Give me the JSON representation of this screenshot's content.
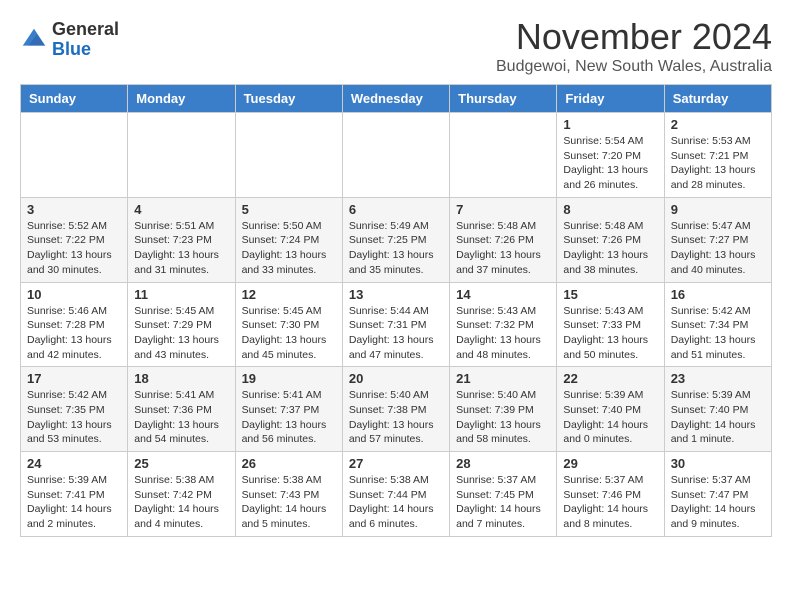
{
  "header": {
    "logo_general": "General",
    "logo_blue": "Blue",
    "month_title": "November 2024",
    "subtitle": "Budgewoi, New South Wales, Australia"
  },
  "days_of_week": [
    "Sunday",
    "Monday",
    "Tuesday",
    "Wednesday",
    "Thursday",
    "Friday",
    "Saturday"
  ],
  "weeks": [
    [
      {
        "day": "",
        "info": ""
      },
      {
        "day": "",
        "info": ""
      },
      {
        "day": "",
        "info": ""
      },
      {
        "day": "",
        "info": ""
      },
      {
        "day": "",
        "info": ""
      },
      {
        "day": "1",
        "info": "Sunrise: 5:54 AM\nSunset: 7:20 PM\nDaylight: 13 hours and 26 minutes."
      },
      {
        "day": "2",
        "info": "Sunrise: 5:53 AM\nSunset: 7:21 PM\nDaylight: 13 hours and 28 minutes."
      }
    ],
    [
      {
        "day": "3",
        "info": "Sunrise: 5:52 AM\nSunset: 7:22 PM\nDaylight: 13 hours and 30 minutes."
      },
      {
        "day": "4",
        "info": "Sunrise: 5:51 AM\nSunset: 7:23 PM\nDaylight: 13 hours and 31 minutes."
      },
      {
        "day": "5",
        "info": "Sunrise: 5:50 AM\nSunset: 7:24 PM\nDaylight: 13 hours and 33 minutes."
      },
      {
        "day": "6",
        "info": "Sunrise: 5:49 AM\nSunset: 7:25 PM\nDaylight: 13 hours and 35 minutes."
      },
      {
        "day": "7",
        "info": "Sunrise: 5:48 AM\nSunset: 7:26 PM\nDaylight: 13 hours and 37 minutes."
      },
      {
        "day": "8",
        "info": "Sunrise: 5:48 AM\nSunset: 7:26 PM\nDaylight: 13 hours and 38 minutes."
      },
      {
        "day": "9",
        "info": "Sunrise: 5:47 AM\nSunset: 7:27 PM\nDaylight: 13 hours and 40 minutes."
      }
    ],
    [
      {
        "day": "10",
        "info": "Sunrise: 5:46 AM\nSunset: 7:28 PM\nDaylight: 13 hours and 42 minutes."
      },
      {
        "day": "11",
        "info": "Sunrise: 5:45 AM\nSunset: 7:29 PM\nDaylight: 13 hours and 43 minutes."
      },
      {
        "day": "12",
        "info": "Sunrise: 5:45 AM\nSunset: 7:30 PM\nDaylight: 13 hours and 45 minutes."
      },
      {
        "day": "13",
        "info": "Sunrise: 5:44 AM\nSunset: 7:31 PM\nDaylight: 13 hours and 47 minutes."
      },
      {
        "day": "14",
        "info": "Sunrise: 5:43 AM\nSunset: 7:32 PM\nDaylight: 13 hours and 48 minutes."
      },
      {
        "day": "15",
        "info": "Sunrise: 5:43 AM\nSunset: 7:33 PM\nDaylight: 13 hours and 50 minutes."
      },
      {
        "day": "16",
        "info": "Sunrise: 5:42 AM\nSunset: 7:34 PM\nDaylight: 13 hours and 51 minutes."
      }
    ],
    [
      {
        "day": "17",
        "info": "Sunrise: 5:42 AM\nSunset: 7:35 PM\nDaylight: 13 hours and 53 minutes."
      },
      {
        "day": "18",
        "info": "Sunrise: 5:41 AM\nSunset: 7:36 PM\nDaylight: 13 hours and 54 minutes."
      },
      {
        "day": "19",
        "info": "Sunrise: 5:41 AM\nSunset: 7:37 PM\nDaylight: 13 hours and 56 minutes."
      },
      {
        "day": "20",
        "info": "Sunrise: 5:40 AM\nSunset: 7:38 PM\nDaylight: 13 hours and 57 minutes."
      },
      {
        "day": "21",
        "info": "Sunrise: 5:40 AM\nSunset: 7:39 PM\nDaylight: 13 hours and 58 minutes."
      },
      {
        "day": "22",
        "info": "Sunrise: 5:39 AM\nSunset: 7:40 PM\nDaylight: 14 hours and 0 minutes."
      },
      {
        "day": "23",
        "info": "Sunrise: 5:39 AM\nSunset: 7:40 PM\nDaylight: 14 hours and 1 minute."
      }
    ],
    [
      {
        "day": "24",
        "info": "Sunrise: 5:39 AM\nSunset: 7:41 PM\nDaylight: 14 hours and 2 minutes."
      },
      {
        "day": "25",
        "info": "Sunrise: 5:38 AM\nSunset: 7:42 PM\nDaylight: 14 hours and 4 minutes."
      },
      {
        "day": "26",
        "info": "Sunrise: 5:38 AM\nSunset: 7:43 PM\nDaylight: 14 hours and 5 minutes."
      },
      {
        "day": "27",
        "info": "Sunrise: 5:38 AM\nSunset: 7:44 PM\nDaylight: 14 hours and 6 minutes."
      },
      {
        "day": "28",
        "info": "Sunrise: 5:37 AM\nSunset: 7:45 PM\nDaylight: 14 hours and 7 minutes."
      },
      {
        "day": "29",
        "info": "Sunrise: 5:37 AM\nSunset: 7:46 PM\nDaylight: 14 hours and 8 minutes."
      },
      {
        "day": "30",
        "info": "Sunrise: 5:37 AM\nSunset: 7:47 PM\nDaylight: 14 hours and 9 minutes."
      }
    ]
  ]
}
